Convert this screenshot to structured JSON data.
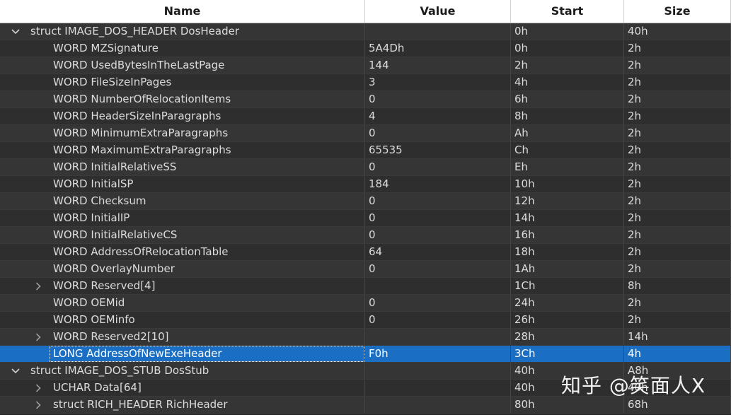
{
  "columns": {
    "name": "Name",
    "value": "Value",
    "start": "Start",
    "size": "Size"
  },
  "rows": [
    {
      "depth": 0,
      "expander": "expanded",
      "name": "struct IMAGE_DOS_HEADER DosHeader",
      "value": "",
      "start": "0h",
      "size": "40h"
    },
    {
      "depth": 1,
      "expander": "none",
      "name": "WORD MZSignature",
      "value": "5A4Dh",
      "start": "0h",
      "size": "2h"
    },
    {
      "depth": 1,
      "expander": "none",
      "name": "WORD UsedBytesInTheLastPage",
      "value": "144",
      "start": "2h",
      "size": "2h"
    },
    {
      "depth": 1,
      "expander": "none",
      "name": "WORD FileSizeInPages",
      "value": "3",
      "start": "4h",
      "size": "2h"
    },
    {
      "depth": 1,
      "expander": "none",
      "name": "WORD NumberOfRelocationItems",
      "value": "0",
      "start": "6h",
      "size": "2h"
    },
    {
      "depth": 1,
      "expander": "none",
      "name": "WORD HeaderSizeInParagraphs",
      "value": "4",
      "start": "8h",
      "size": "2h"
    },
    {
      "depth": 1,
      "expander": "none",
      "name": "WORD MinimumExtraParagraphs",
      "value": "0",
      "start": "Ah",
      "size": "2h"
    },
    {
      "depth": 1,
      "expander": "none",
      "name": "WORD MaximumExtraParagraphs",
      "value": "65535",
      "start": "Ch",
      "size": "2h"
    },
    {
      "depth": 1,
      "expander": "none",
      "name": "WORD InitialRelativeSS",
      "value": "0",
      "start": "Eh",
      "size": "2h"
    },
    {
      "depth": 1,
      "expander": "none",
      "name": "WORD InitialSP",
      "value": "184",
      "start": "10h",
      "size": "2h"
    },
    {
      "depth": 1,
      "expander": "none",
      "name": "WORD Checksum",
      "value": "0",
      "start": "12h",
      "size": "2h"
    },
    {
      "depth": 1,
      "expander": "none",
      "name": "WORD InitialIP",
      "value": "0",
      "start": "14h",
      "size": "2h"
    },
    {
      "depth": 1,
      "expander": "none",
      "name": "WORD InitialRelativeCS",
      "value": "0",
      "start": "16h",
      "size": "2h"
    },
    {
      "depth": 1,
      "expander": "none",
      "name": "WORD AddressOfRelocationTable",
      "value": "64",
      "start": "18h",
      "size": "2h"
    },
    {
      "depth": 1,
      "expander": "none",
      "name": "WORD OverlayNumber",
      "value": "0",
      "start": "1Ah",
      "size": "2h"
    },
    {
      "depth": 1,
      "expander": "collapsed",
      "name": "WORD Reserved[4]",
      "value": "",
      "start": "1Ch",
      "size": "8h"
    },
    {
      "depth": 1,
      "expander": "none",
      "name": "WORD OEMid",
      "value": "0",
      "start": "24h",
      "size": "2h"
    },
    {
      "depth": 1,
      "expander": "none",
      "name": "WORD OEMinfo",
      "value": "0",
      "start": "26h",
      "size": "2h"
    },
    {
      "depth": 1,
      "expander": "collapsed",
      "name": "WORD Reserved2[10]",
      "value": "",
      "start": "28h",
      "size": "14h"
    },
    {
      "depth": 1,
      "expander": "none",
      "name": "LONG AddressOfNewExeHeader",
      "value": "F0h",
      "start": "3Ch",
      "size": "4h",
      "selected": true
    },
    {
      "depth": 0,
      "expander": "expanded",
      "name": "struct IMAGE_DOS_STUB DosStub",
      "value": "",
      "start": "40h",
      "size": "A8h"
    },
    {
      "depth": 1,
      "expander": "collapsed",
      "name": "UCHAR Data[64]",
      "value": "",
      "start": "40h",
      "size": "40h"
    },
    {
      "depth": 1,
      "expander": "collapsed",
      "name": "struct RICH_HEADER RichHeader",
      "value": "",
      "start": "80h",
      "size": "68h"
    }
  ],
  "icons": {
    "expanded": "chevron-down-icon",
    "collapsed": "chevron-right-icon"
  },
  "colors": {
    "selection": "#1a6fc4",
    "header_bg": "#ffffff",
    "row_bg": "#2e2e2e"
  },
  "watermark": "知乎 @笑面人X"
}
